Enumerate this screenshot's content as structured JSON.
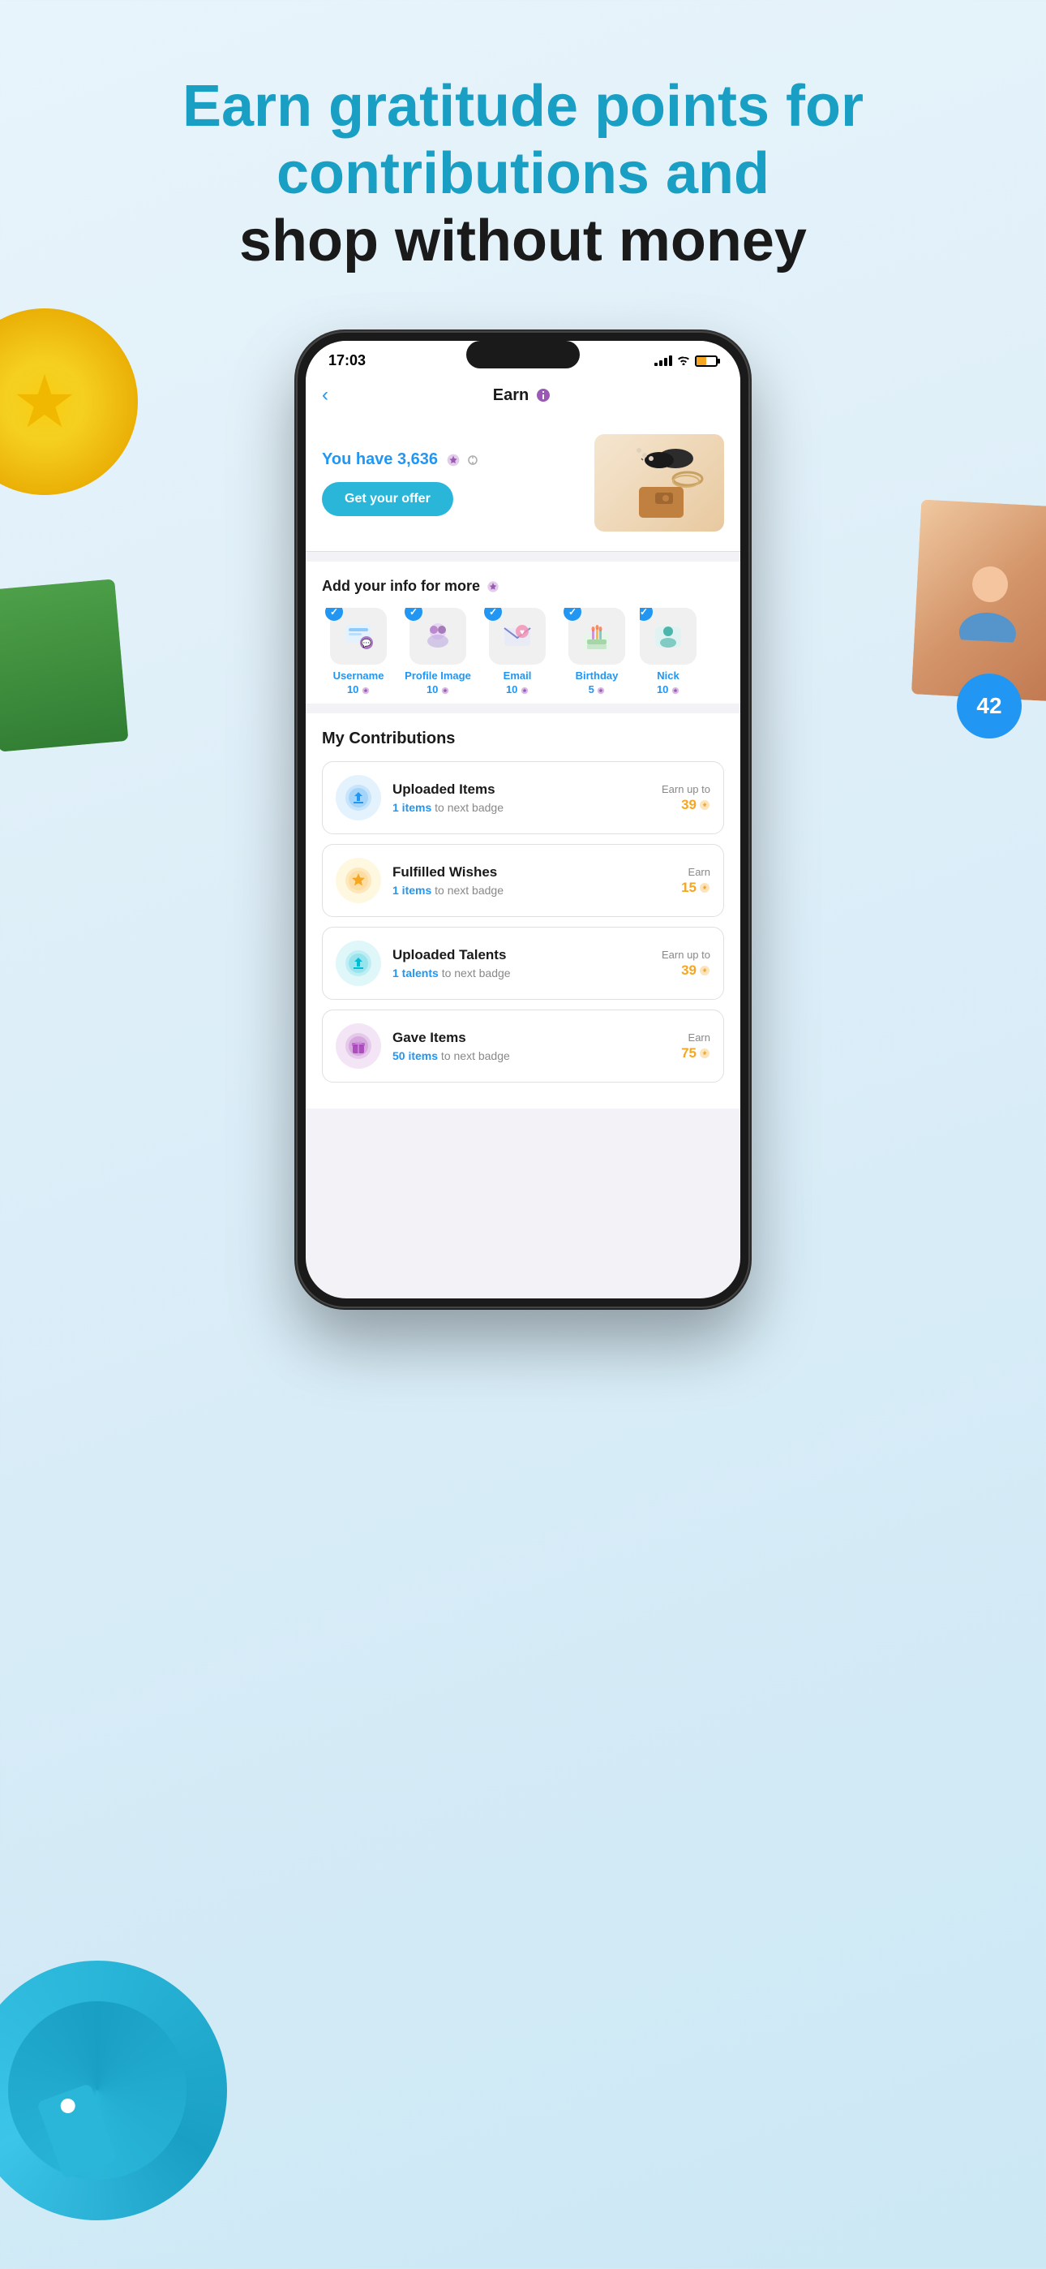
{
  "page": {
    "headline": {
      "line1": "Earn gratitude points for",
      "line2": "contributions and",
      "line3": "shop without money"
    }
  },
  "phone": {
    "statusBar": {
      "time": "17:03",
      "signal": [
        3,
        4,
        5,
        6,
        7
      ],
      "batteryLevel": "50%"
    },
    "navBar": {
      "title": "Earn",
      "backLabel": "‹"
    },
    "heroBanner": {
      "label": "You have ",
      "points": "3,636",
      "btnLabel": "Get your offer"
    },
    "infoSection": {
      "title": "Add your info for more",
      "items": [
        {
          "label": "Username\n10",
          "icon": "📱",
          "checked": true
        },
        {
          "label": "Profile Image\n10",
          "icon": "👫",
          "checked": true
        },
        {
          "label": "Email\n10",
          "icon": "✉️",
          "checked": true
        },
        {
          "label": "Birthday\n5",
          "icon": "🎂",
          "checked": true
        },
        {
          "label": "Nick\n10",
          "icon": "🔷",
          "checked": true
        }
      ]
    },
    "contributions": {
      "title": "My Contributions",
      "items": [
        {
          "title": "Uploaded Items",
          "sub_prefix": "1 items",
          "sub_suffix": " to next badge",
          "icon": "🔵",
          "iconBg": "blue",
          "earnLabel": "Earn up to",
          "earnAmount": "39"
        },
        {
          "title": "Fulfilled Wishes",
          "sub_prefix": "1 items",
          "sub_suffix": " to next badge",
          "icon": "⭐",
          "iconBg": "gold",
          "earnLabel": "Earn",
          "earnAmount": "15"
        },
        {
          "title": "Uploaded Talents",
          "sub_prefix": "1 talents",
          "sub_suffix": " to next\nbadge",
          "icon": "🔵",
          "iconBg": "teal",
          "earnLabel": "Earn up to",
          "earnAmount": "39"
        },
        {
          "title": "Gave Items",
          "sub_prefix": "50 items",
          "sub_suffix": " to next badge",
          "icon": "🟣",
          "iconBg": "purple",
          "earnLabel": "Earn",
          "earnAmount": "75"
        }
      ]
    }
  },
  "deco": {
    "badge42": "42"
  }
}
